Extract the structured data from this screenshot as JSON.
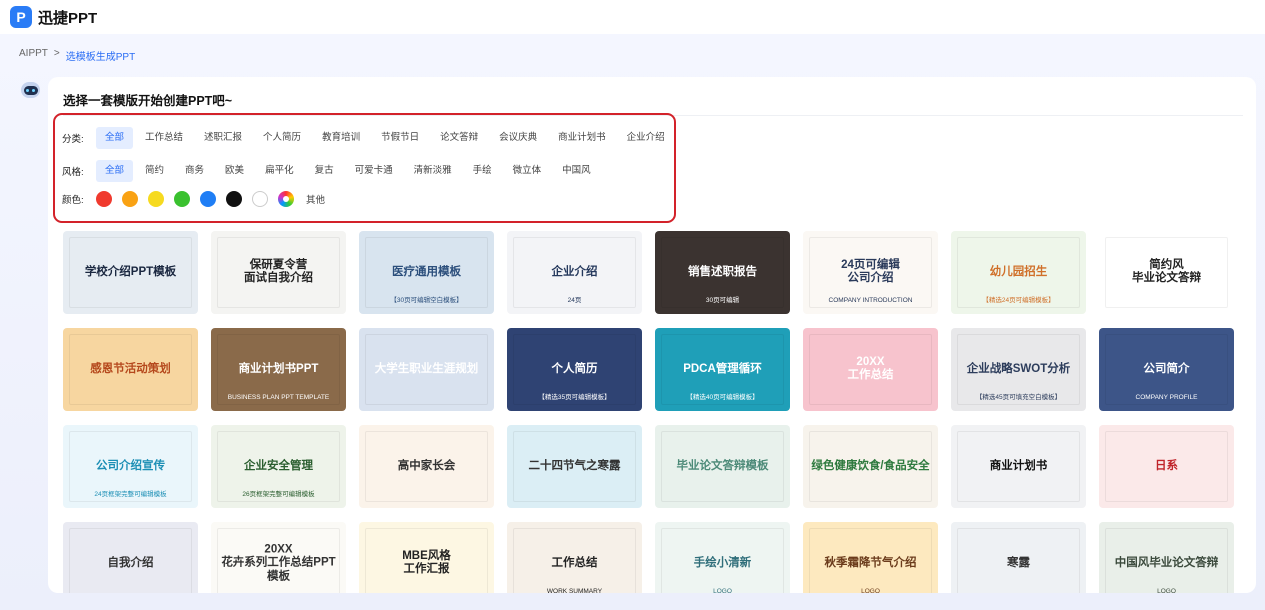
{
  "app": {
    "name": "迅捷PPT",
    "logo_letter": "P"
  },
  "breadcrumb": {
    "root": "AIPPT",
    "separator": ">",
    "current": "选模板生成PPT"
  },
  "panel": {
    "title": "选择一套模版开始创建PPT吧~"
  },
  "filters": {
    "category": {
      "label": "分类:",
      "options": [
        "全部",
        "工作总结",
        "述职汇报",
        "个人简历",
        "教育培训",
        "节假节日",
        "论文答辩",
        "会议庆典",
        "商业计划书",
        "企业介绍"
      ],
      "selected": "全部"
    },
    "style": {
      "label": "风格:",
      "options": [
        "全部",
        "简约",
        "商务",
        "欧美",
        "扁平化",
        "复古",
        "可爱卡通",
        "清新淡雅",
        "手绘",
        "微立体",
        "中国风"
      ],
      "selected": "全部"
    },
    "color": {
      "label": "颜色:",
      "swatches": [
        "#f03a2e",
        "#f9a214",
        "#f6da20",
        "#3ac12f",
        "#1f7ef5",
        "#111111",
        "#ffffff"
      ],
      "other_label": "其他"
    }
  },
  "templates": [
    {
      "title": "学校介绍PPT模板",
      "sub": "",
      "bg": "#e6ecf2",
      "fg": "#1a2740"
    },
    {
      "title": "保研夏令营\n面试自我介绍",
      "sub": "",
      "bg": "#f4f4f2",
      "fg": "#222222"
    },
    {
      "title": "医疗通用模板",
      "sub": "【30页可编辑空白模板】",
      "bg": "#d8e4ef",
      "fg": "#2c4f7c"
    },
    {
      "title": "企业介绍",
      "sub": "24页",
      "bg": "#f3f4f7",
      "fg": "#24385c"
    },
    {
      "title": "销售述职报告",
      "sub": "30页可编辑",
      "bg": "#3b3330",
      "fg": "#ffffff"
    },
    {
      "title": "24页可编辑\n公司介绍",
      "sub": "COMPANY INTRODUCTION",
      "bg": "#fbf8f4",
      "fg": "#2a3a5a"
    },
    {
      "title": "幼儿园招生",
      "sub": "【精选24页可编辑模板】",
      "bg": "#eef6ea",
      "fg": "#d0702a"
    },
    {
      "title": "简约风\n毕业论文答辩",
      "sub": "",
      "bg": "#ffffff",
      "fg": "#222222"
    },
    {
      "title": "感恩节活动策划",
      "sub": "",
      "bg": "#f7d6a0",
      "fg": "#b5481c"
    },
    {
      "title": "商业计划书PPT",
      "sub": "BUSINESS PLAN PPT TEMPLATE",
      "bg": "#8a6a4a",
      "fg": "#ffffff"
    },
    {
      "title": "大学生职业生涯规划",
      "sub": "",
      "bg": "#d9e2ef",
      "fg": "#ffffff"
    },
    {
      "title": "个人简历",
      "sub": "【精选35页可编辑模板】",
      "bg": "#2f4373",
      "fg": "#ffffff"
    },
    {
      "title": "PDCA管理循环",
      "sub": "【精选40页可编辑模板】",
      "bg": "#1f9fb8",
      "fg": "#ffffff"
    },
    {
      "title": "20XX\n工作总结",
      "sub": "",
      "bg": "#f7c3cd",
      "fg": "#ffffff"
    },
    {
      "title": "企业战略SWOT分析",
      "sub": "【精选45页可填充空白模板】",
      "bg": "#e8e8ea",
      "fg": "#2d3d5c"
    },
    {
      "title": "公司简介",
      "sub": "COMPANY PROFILE",
      "bg": "#3d5588",
      "fg": "#ffffff"
    },
    {
      "title": "公司介绍宣传",
      "sub": "24页框架完整可编辑模板",
      "bg": "#eaf6fb",
      "fg": "#1c8fb5"
    },
    {
      "title": "企业安全管理",
      "sub": "26页框架完整可编辑模板",
      "bg": "#eef3ea",
      "fg": "#2a5e2f"
    },
    {
      "title": "高中家长会",
      "sub": "",
      "bg": "#fbf3ea",
      "fg": "#333333"
    },
    {
      "title": "二十四节气之寒露",
      "sub": "",
      "bg": "#dbeef5",
      "fg": "#333333"
    },
    {
      "title": "毕业论文答辩模板",
      "sub": "",
      "bg": "#e8f1ec",
      "fg": "#4c8a78"
    },
    {
      "title": "绿色健康饮食/食品安全",
      "sub": "",
      "bg": "#f7f3ec",
      "fg": "#2e7a3e"
    },
    {
      "title": "商业计划书",
      "sub": "",
      "bg": "#f1f2f4",
      "fg": "#111111"
    },
    {
      "title": "日系",
      "sub": "",
      "bg": "#fbe9e9",
      "fg": "#c0242a"
    },
    {
      "title": "自我介绍",
      "sub": "",
      "bg": "#e9eaf2",
      "fg": "#333333"
    },
    {
      "title": "20XX\n花卉系列工作总结PPT模板",
      "sub": "",
      "bg": "#fbfaf6",
      "fg": "#333333"
    },
    {
      "title": "MBE风格\n工作汇报",
      "sub": "",
      "bg": "#fdf7e3",
      "fg": "#222222"
    },
    {
      "title": "工作总结",
      "sub": "WORK SUMMARY",
      "bg": "#f6f0e8",
      "fg": "#222222"
    },
    {
      "title": "手绘小清新",
      "sub": "LOGO",
      "bg": "#eef5f2",
      "fg": "#2f6e7a"
    },
    {
      "title": "秋季霜降节气介绍",
      "sub": "LOGO",
      "bg": "#fde9bf",
      "fg": "#6b3b1b"
    },
    {
      "title": "寒露",
      "sub": "",
      "bg": "#eef1f4",
      "fg": "#333333"
    },
    {
      "title": "中国风毕业论文答辩",
      "sub": "LOGO",
      "bg": "#e9efe9",
      "fg": "#3b4a3c"
    }
  ]
}
